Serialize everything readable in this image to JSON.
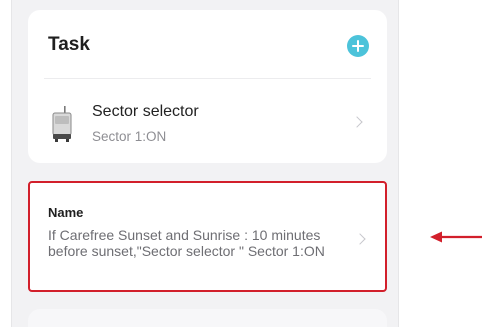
{
  "task": {
    "title": "Task",
    "add_icon": "plus-circle-icon",
    "accent_color": "#4cc3da",
    "device": {
      "name": "Sector selector",
      "status": "Sector 1:ON",
      "icon": "device-controller-icon"
    }
  },
  "name_row": {
    "label": "Name",
    "value": "If Carefree Sunset and Sunrise : 10 minutes before sunset,\"Sector selector \" Sector 1:ON",
    "highlight_color": "#d21f2b"
  },
  "annotation": {
    "arrow_icon": "arrow-left-icon",
    "color": "#d21f2b"
  }
}
